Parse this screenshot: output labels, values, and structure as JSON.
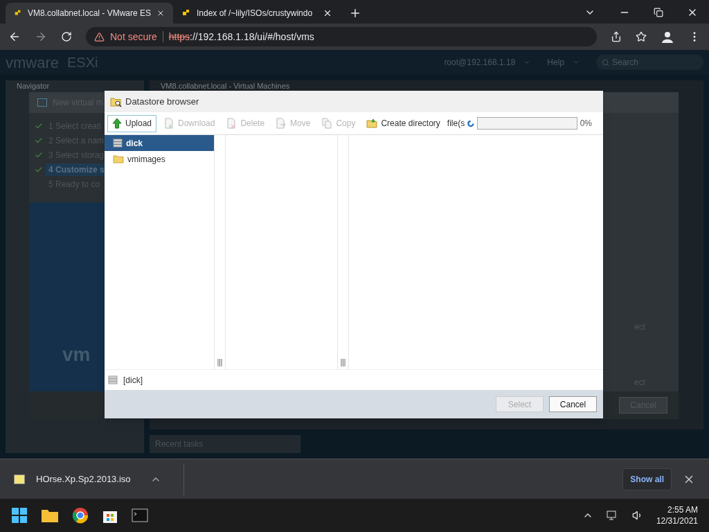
{
  "browser": {
    "tabs": [
      {
        "title": "VM8.collabnet.local - VMware ES",
        "selected": true
      },
      {
        "title": "Index of /~lily/ISOs/crustywindo",
        "selected": false
      }
    ],
    "address": {
      "security": "Not secure",
      "scheme": "https",
      "rest": "://192.168.1.18/ui/#/host/vms"
    }
  },
  "esxi": {
    "brand": "vmware",
    "product": "ESXi",
    "user": "root@192.168.1.18",
    "help": "Help",
    "search_placeholder": "Search",
    "navigator": "Navigator",
    "breadcrumb": "VM8.collabnet.local - Virtual Machines",
    "recent_tasks": "Recent tasks"
  },
  "wizard": {
    "title": "New virtual m",
    "steps": [
      {
        "label": "1 Select creati",
        "done": true,
        "selected": false
      },
      {
        "label": "2 Select a nam",
        "done": true,
        "selected": false
      },
      {
        "label": "3 Select storag",
        "done": true,
        "selected": false
      },
      {
        "label": "4 Customize s",
        "done": true,
        "selected": true
      },
      {
        "label": "5 Ready to co",
        "done": false,
        "selected": false
      }
    ],
    "brand": "vm",
    "right_texts": [
      "ect",
      "ect"
    ],
    "cancel": "Cancel"
  },
  "datastore_browser": {
    "title": "Datastore browser",
    "toolbar": [
      {
        "label": "Upload",
        "kind": "upload",
        "disabled": false
      },
      {
        "label": "Download",
        "kind": "download",
        "disabled": true
      },
      {
        "label": "Delete",
        "kind": "delete",
        "disabled": true
      },
      {
        "label": "Move",
        "kind": "move",
        "disabled": true
      },
      {
        "label": "Copy",
        "kind": "copy",
        "disabled": true
      },
      {
        "label": "Create directory",
        "kind": "folder",
        "disabled": false
      }
    ],
    "upload": {
      "label": "file(s",
      "level": 0,
      "percent": "0%"
    },
    "items": [
      {
        "name": "dick",
        "kind": "datastore",
        "selected": true
      },
      {
        "name": "vmimages",
        "kind": "folder",
        "selected": false
      }
    ],
    "path": "[dick]",
    "buttons": [
      {
        "label": "Select",
        "disabled": true
      },
      {
        "label": "Cancel",
        "disabled": false
      }
    ]
  },
  "downloads": {
    "file": "HOrse.Xp.Sp2.2013.iso",
    "show_all": "Show all"
  },
  "taskbar": {
    "time": "2:55 AM",
    "date": "12/31/2021"
  }
}
